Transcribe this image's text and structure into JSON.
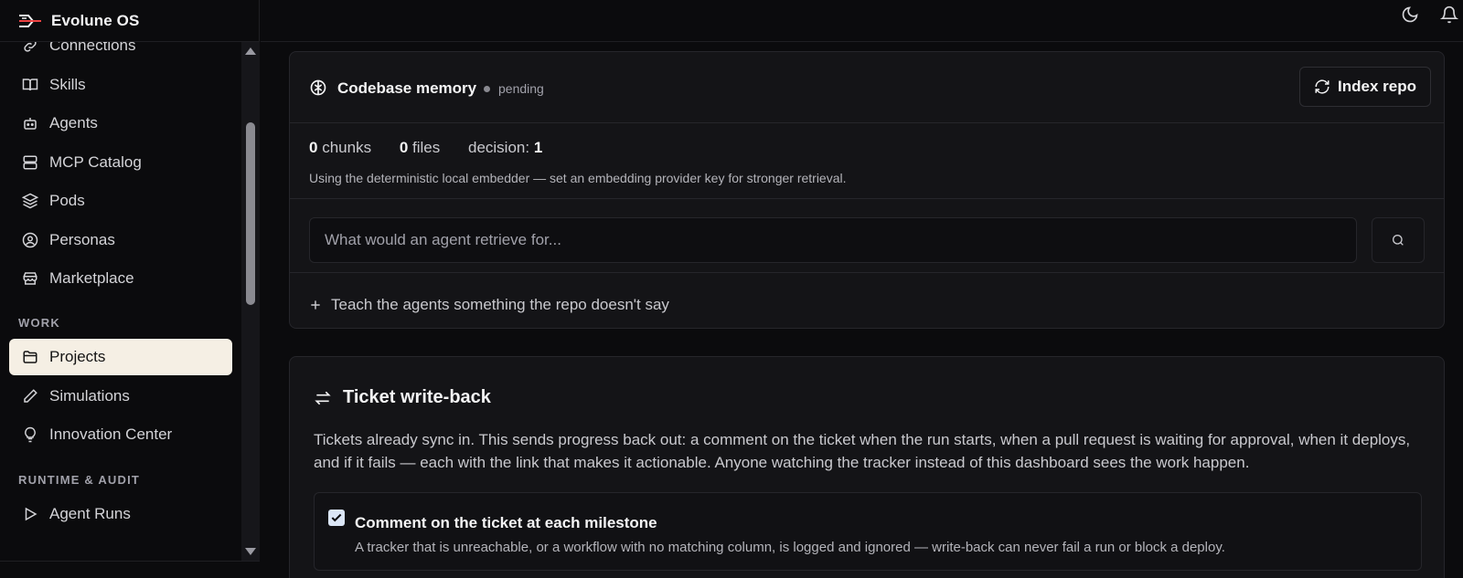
{
  "app": {
    "name": "Evolune OS"
  },
  "sidebar": {
    "items_top": [
      {
        "label": "Connections",
        "icon": "link-icon"
      },
      {
        "label": "Skills",
        "icon": "book-icon"
      },
      {
        "label": "Agents",
        "icon": "bot-icon"
      },
      {
        "label": "MCP Catalog",
        "icon": "server-icon"
      },
      {
        "label": "Pods",
        "icon": "layers-icon"
      },
      {
        "label": "Personas",
        "icon": "user-circle-icon"
      },
      {
        "label": "Marketplace",
        "icon": "store-icon"
      }
    ],
    "work_label": "WORK",
    "work_items": [
      {
        "label": "Projects",
        "icon": "folder-icon",
        "active": true
      },
      {
        "label": "Simulations",
        "icon": "pencil-icon"
      },
      {
        "label": "Innovation Center",
        "icon": "lightbulb-icon"
      }
    ],
    "runtime_label": "RUNTIME & AUDIT",
    "runtime_items": [
      {
        "label": "Agent Runs",
        "icon": "play-icon"
      }
    ]
  },
  "topbar": {
    "icons": [
      "moon-icon",
      "bell-icon"
    ]
  },
  "codebase_memory": {
    "title": "Codebase memory",
    "status": "pending",
    "index_button": "Index repo",
    "chunks_value": "0",
    "chunks_label": "chunks",
    "files_value": "0",
    "files_label": "files",
    "decision_label": "decision:",
    "decision_value": "1",
    "hint": "Using the deterministic local embedder — set an embedding provider key for stronger retrieval.",
    "search_placeholder": "What would an agent retrieve for...",
    "teach_label": "Teach the agents something the repo doesn't say"
  },
  "ticket_writeback": {
    "title": "Ticket write-back",
    "description": "Tickets already sync in. This sends progress back out: a comment on the ticket when the run starts, when a pull request is waiting for approval, when it deploys, and if it fails — each with the link that makes it actionable. Anyone watching the tracker instead of this dashboard sees the work happen.",
    "milestone_label": "Comment on the ticket at each milestone",
    "milestone_checked": true,
    "milestone_hint": "A tracker that is unreachable, or a workflow with no matching column, is logged and ignored — write-back can never fail a run or block a deploy."
  }
}
